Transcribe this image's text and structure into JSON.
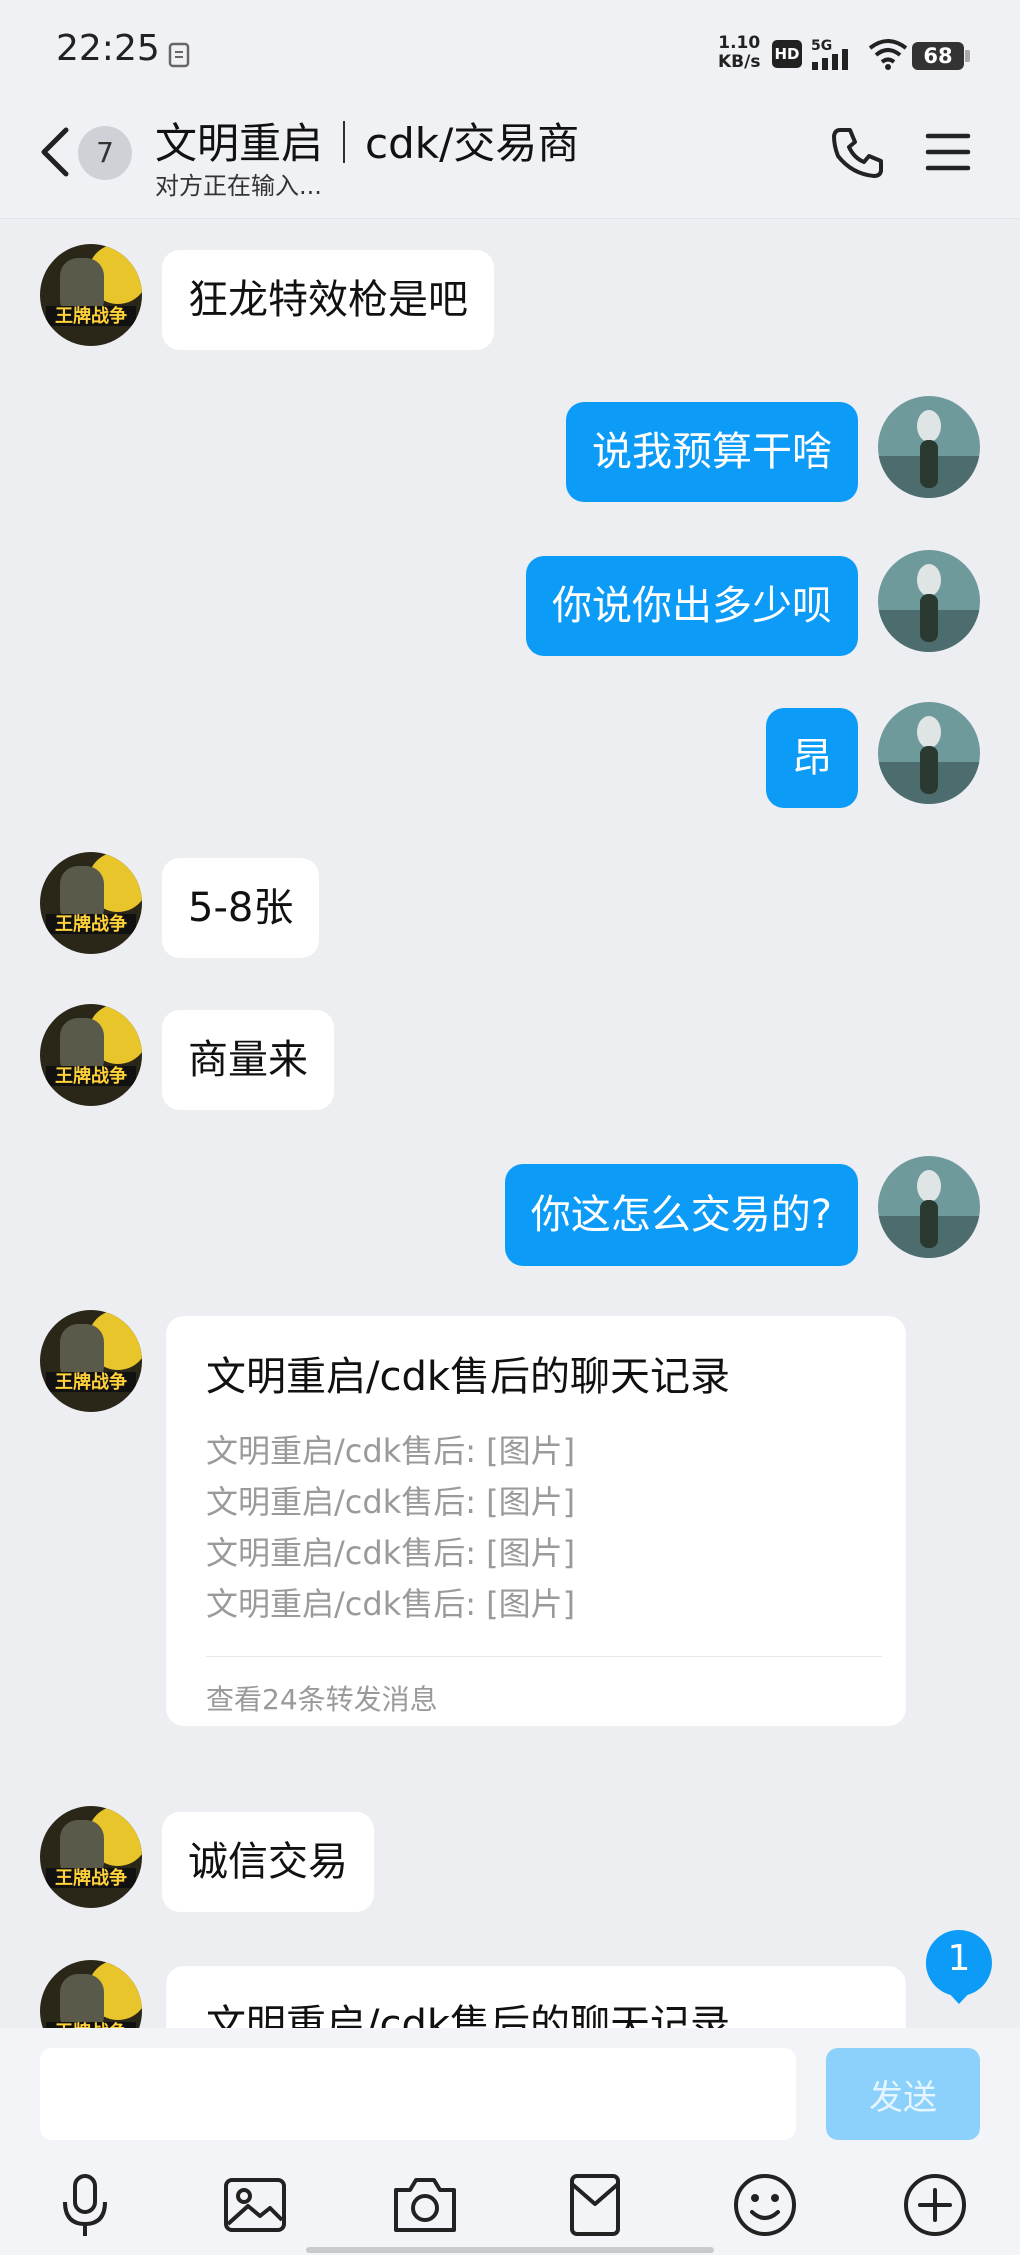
{
  "status_bar": {
    "time": "22:25",
    "net_speed_value": "1.10",
    "net_speed_unit": "KB/s",
    "hd_label": "HD",
    "signal_label": "5G",
    "battery": "68"
  },
  "header": {
    "unread_count": "7",
    "title": "文明重启｜cdk/交易商",
    "subtitle": "对方正在输入..."
  },
  "messages": [
    {
      "side": "in",
      "text": "狂龙特效枪是吧"
    },
    {
      "side": "out",
      "text": "说我预算干啥"
    },
    {
      "side": "out",
      "text": "你说你出多少呗"
    },
    {
      "side": "out",
      "text": "昂"
    },
    {
      "side": "in",
      "text": "5-8张"
    },
    {
      "side": "in",
      "text": "商量来"
    },
    {
      "side": "out",
      "text": "你这怎么交易的?"
    },
    {
      "side": "in",
      "type": "forward",
      "title": "文明重启/cdk售后的聊天记录",
      "lines": [
        "文明重启/cdk售后: [图片]",
        "文明重启/cdk售后: [图片]",
        "文明重启/cdk售后: [图片]",
        "文明重启/cdk售后: [图片]"
      ],
      "footer": "查看24条转发消息"
    },
    {
      "side": "in",
      "text": "诚信交易"
    },
    {
      "side": "in",
      "type": "forward",
      "title": "文明重启/cdk售后的聊天记录"
    }
  ],
  "new_message_badge": "1",
  "input": {
    "value": "",
    "send_label": "发送"
  },
  "toolbar_icons": [
    "microphone-icon",
    "image-icon",
    "camera-icon",
    "red-packet-icon",
    "emoji-icon",
    "plus-icon"
  ],
  "colors": {
    "outgoing_bubble": "#0c9bf7",
    "incoming_bubble": "#ffffff",
    "background": "#edeef2",
    "send_button_disabled": "#8cd1fb"
  },
  "avatars": {
    "contact_text": "王牌战争"
  }
}
